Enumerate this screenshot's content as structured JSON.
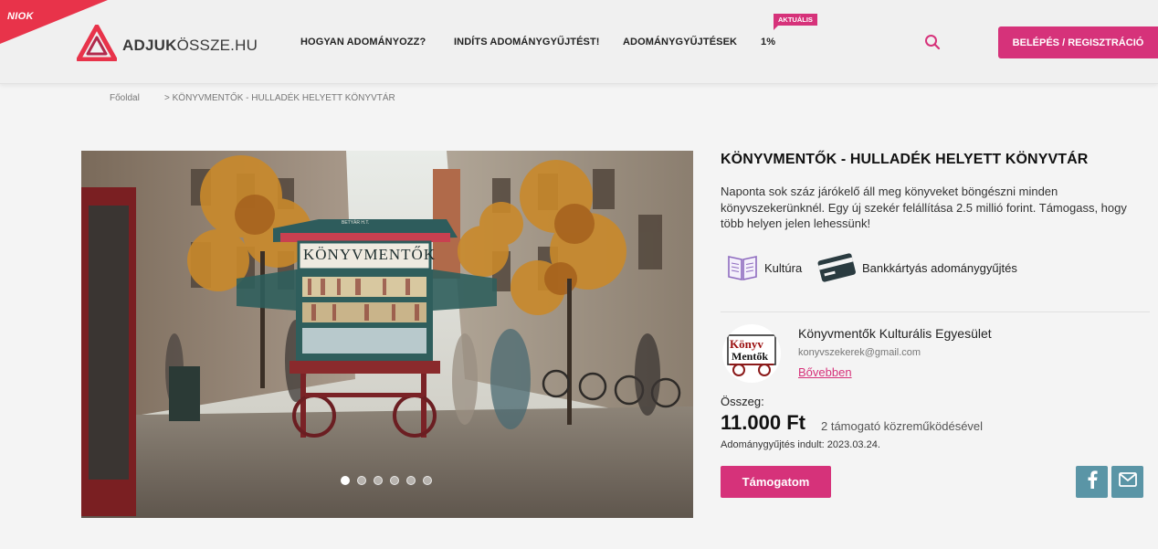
{
  "header": {
    "corner_label": "NIOK",
    "logo": {
      "bold": "ADJUK",
      "rest": "ÖSSZE.HU"
    },
    "nav": [
      {
        "label": "HOGYAN ADOMÁNYOZZ?"
      },
      {
        "label": "INDÍTS ADOMÁNYGYŰJTÉST!"
      },
      {
        "label": "ADOMÁNYGYŰJTÉSEK"
      },
      {
        "label": "1%"
      }
    ],
    "badge": "AKTUÁLIS",
    "search_icon": "search-icon",
    "login_label": "BELÉPÉS / REGISZTRÁCIÓ"
  },
  "breadcrumb": {
    "home": "Főoldal",
    "current": "> KÖNYVMENTŐK - HULLADÉK HELYETT KÖNYVTÁR"
  },
  "photo": {
    "sign_text": "KÖNYVMENTŐK",
    "small_sign": "BETYÁR H.T.",
    "slide_count": 6,
    "active_slide": 1
  },
  "campaign": {
    "title": "KÖNYVMENTŐK - HULLADÉK HELYETT KÖNYVTÁR",
    "description": "Naponta sok száz járókelő áll meg könyveket böngészni minden könyvszekerünknél. Egy új szekér felállítása 2.5 millió forint. Támogass, hogy több helyen jelen lehessünk!",
    "tags": [
      {
        "icon": "book-icon",
        "label": "Kultúra"
      },
      {
        "icon": "credit-card-icon",
        "label": "Bankkártyás adománygyűjtés"
      }
    ]
  },
  "organization": {
    "logo_line1": "Könyv",
    "logo_line2": "Mentők",
    "name": "Könyvmentők Kulturális Egyesület",
    "email": "konyvszekerek@gmail.com",
    "more_link": "Bővebben"
  },
  "donation": {
    "amount_label": "Összeg:",
    "amount": "11.000 Ft",
    "supporters": "2 támogató közreműködésével",
    "started": "Adománygyűjtés indult: 2023.03.24.",
    "support_button": "Támogatom"
  },
  "share": [
    {
      "icon": "facebook-icon"
    },
    {
      "icon": "mail-icon"
    }
  ],
  "colors": {
    "accent": "#d6327a",
    "share": "#5a95a6",
    "niok": "#e8334a"
  }
}
